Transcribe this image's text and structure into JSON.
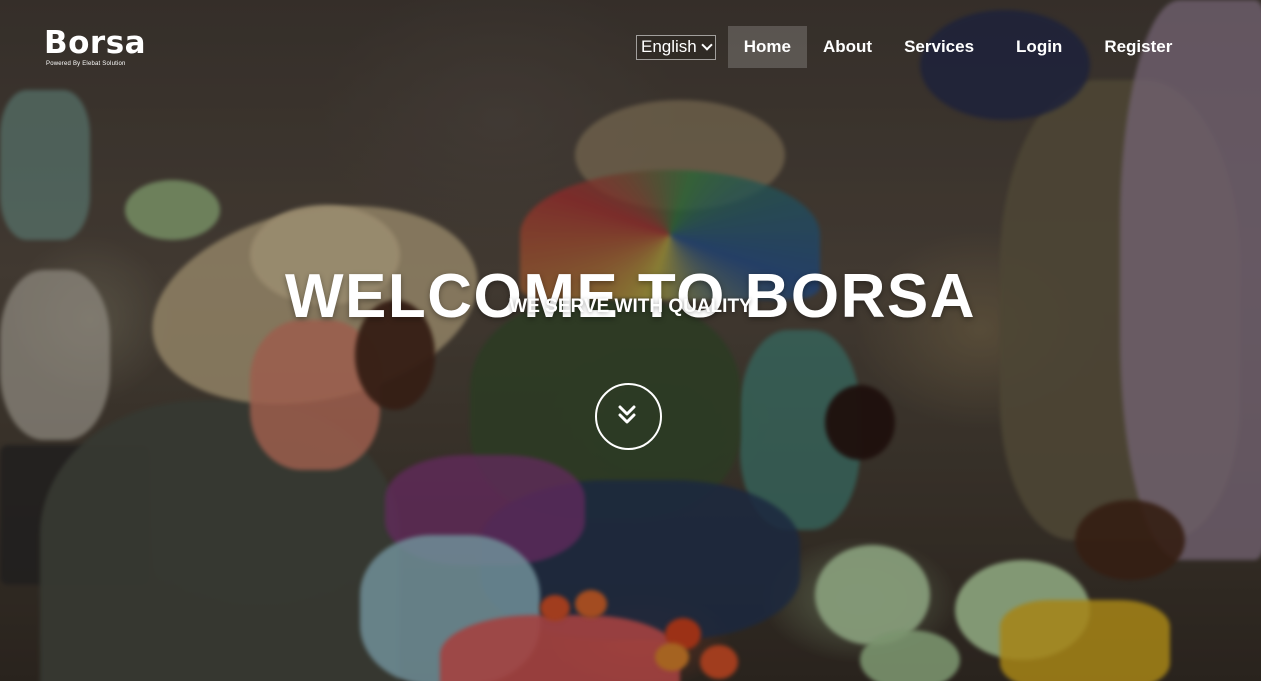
{
  "brand": {
    "name": "Borsa",
    "tagline": "Powered By Elebat Solution"
  },
  "nav": {
    "language": "English",
    "items": [
      {
        "label": "Home",
        "active": true
      },
      {
        "label": "About"
      },
      {
        "label": "Services"
      },
      {
        "label": "Login"
      },
      {
        "label": "Register"
      }
    ]
  },
  "hero": {
    "title": "WELCOME TO BORSA",
    "subtitle": "WE SERVE WITH QUALITY",
    "scroll_icon": "double-chevron-down-icon"
  },
  "colors": {
    "text": "#ffffff",
    "active_nav_bg": "rgba(255,255,255,0.18)"
  }
}
